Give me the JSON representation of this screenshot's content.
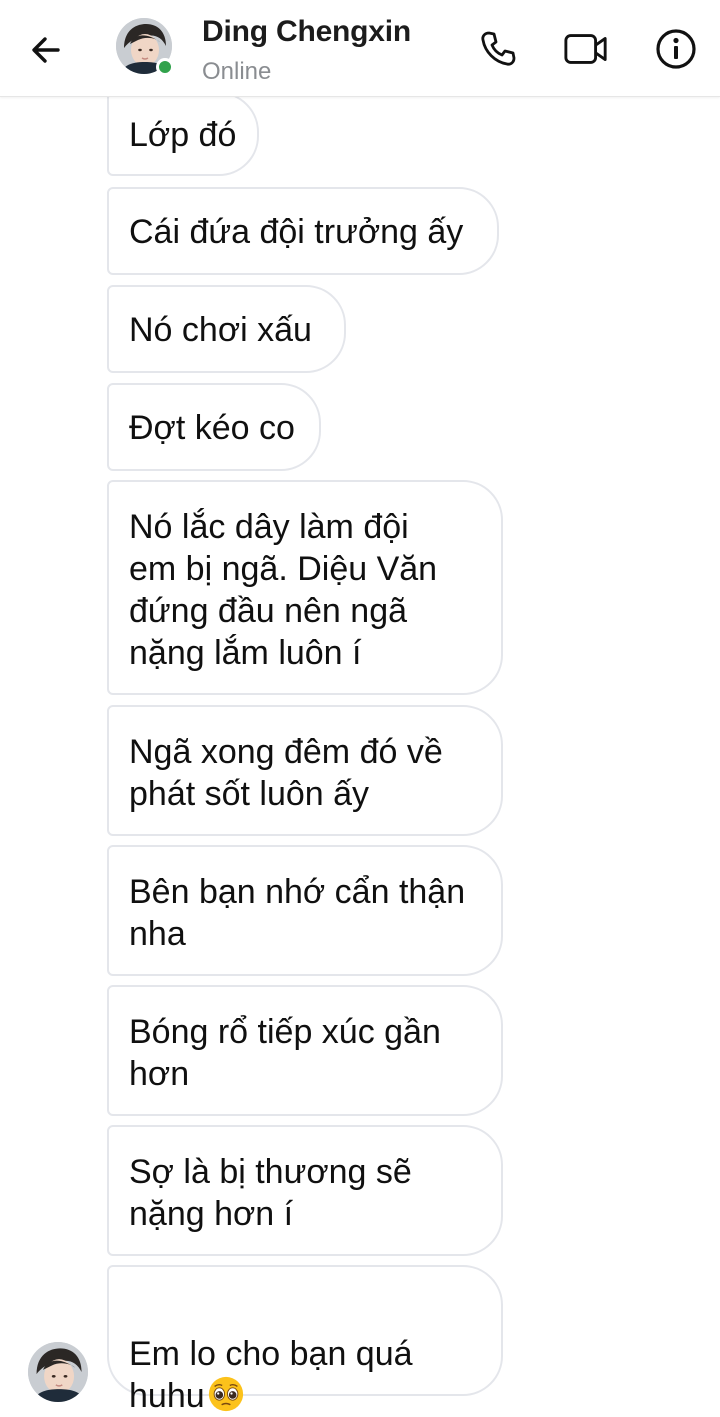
{
  "header": {
    "contact_name": "Ding Chengxin",
    "status": "Online",
    "status_color": "#31a24c"
  },
  "icons": {
    "back": "arrow-left-icon",
    "phone": "phone-icon",
    "video": "video-camera-icon",
    "info": "info-icon"
  },
  "messages": [
    {
      "text": "Lớp đó"
    },
    {
      "text": "Cái đứa đội trưởng ấy"
    },
    {
      "text": "Nó chơi xấu"
    },
    {
      "text": "Đợt kéo co"
    },
    {
      "text": "Nó lắc dây làm đội\nem bị ngã. Diệu Văn\nđứng đầu nên ngã\nnặng lắm luôn í"
    },
    {
      "text": "Ngã xong đêm đó về\nphát sốt luôn ấy"
    },
    {
      "text": "Bên bạn nhớ cẩn thận\nnha"
    },
    {
      "text": "Bóng rổ tiếp xúc gần\nhơn"
    },
    {
      "text": "Sợ là bị thương sẽ\nnặng hơn í"
    },
    {
      "text": "Em lo cho bạn quá\nhuhu",
      "emoji": "pleading-face-emoji"
    }
  ]
}
